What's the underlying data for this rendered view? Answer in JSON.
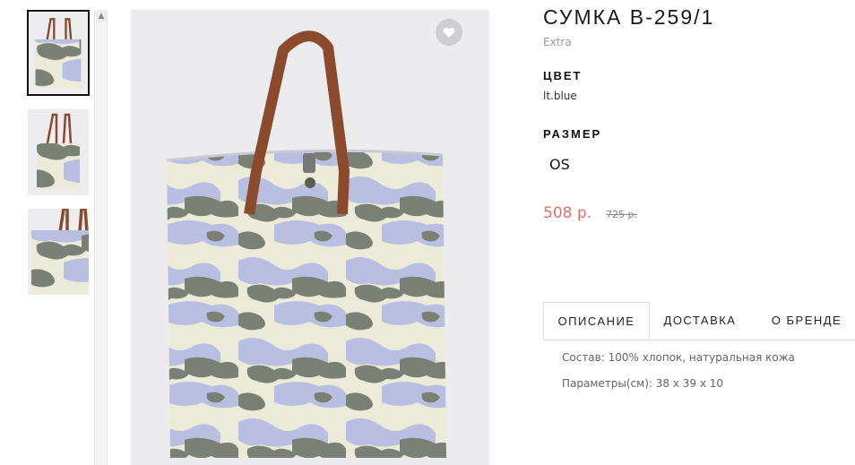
{
  "product": {
    "title": "СУМКА B-259/1",
    "brand": "Extra",
    "color_label": "ЦВЕТ",
    "color_value": "lt.blue",
    "size_label": "РАЗМЕР",
    "size_option": "OS",
    "price": "508 р.",
    "old_price": "725 р."
  },
  "gallery": {
    "thumbnails": [
      "bag-front",
      "bag-front-small",
      "bag-detail"
    ],
    "favorite_icon": "heart-icon",
    "scroll_up_symbol": "▲"
  },
  "tabs": [
    {
      "label": "ОПИСАНИЕ",
      "active": true
    },
    {
      "label": "ДОСТАВКА",
      "active": false
    },
    {
      "label": "О БРЕНДЕ",
      "active": false
    }
  ],
  "description": {
    "composition": "Состав: 100% хлопок, натуральная кожа",
    "dimensions": "Параметры(см): 38 x 39 x 10"
  },
  "colors": {
    "price": "#e2706a",
    "handle": "#8b4a2b",
    "camo_dark": "#7b8075",
    "camo_light": "#b9bfe0",
    "camo_cream": "#ecebd9"
  }
}
